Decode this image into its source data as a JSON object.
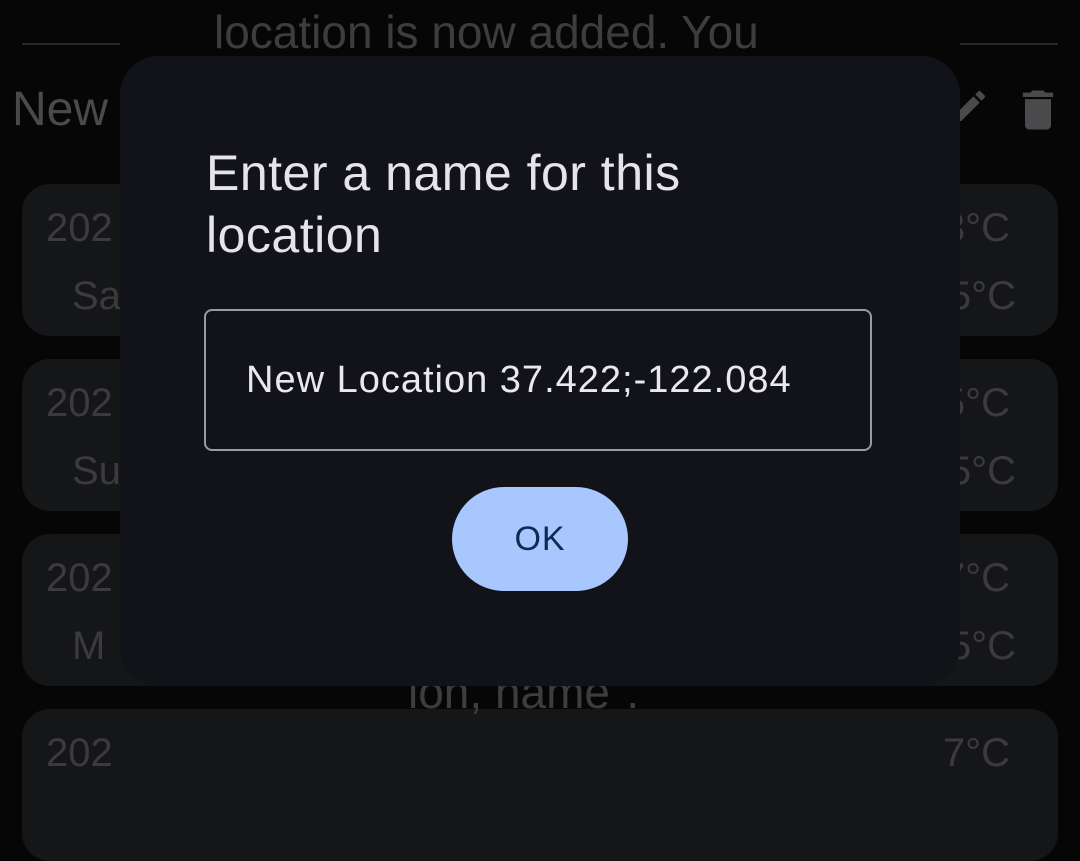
{
  "background": {
    "top_text": "location is now added. You",
    "heading": "New",
    "icons": [
      "edit-icon",
      "delete-icon"
    ],
    "cards": [
      {
        "date": "202",
        "day": "Sa",
        "temp_high": "3°C",
        "temp_low": "5°C"
      },
      {
        "date": "202",
        "day": "Su",
        "temp_high": "5°C",
        "temp_low": "5°C"
      },
      {
        "date": "202",
        "day": "M",
        "temp_high": "7°C",
        "temp_low": "5°C"
      },
      {
        "date": "202",
        "day": "",
        "temp_high": "7°C",
        "temp_low": ""
      }
    ],
    "bottom_text": "ion, name\"."
  },
  "dialog": {
    "title": "Enter a name for this location",
    "field_value": "New Location 37.422;-122.084",
    "ok_label": "OK"
  },
  "colors": {
    "scrim": "#060607",
    "dialog_bg": "#121318",
    "button_bg": "#a8c7ff",
    "button_text": "#0f2b55"
  }
}
